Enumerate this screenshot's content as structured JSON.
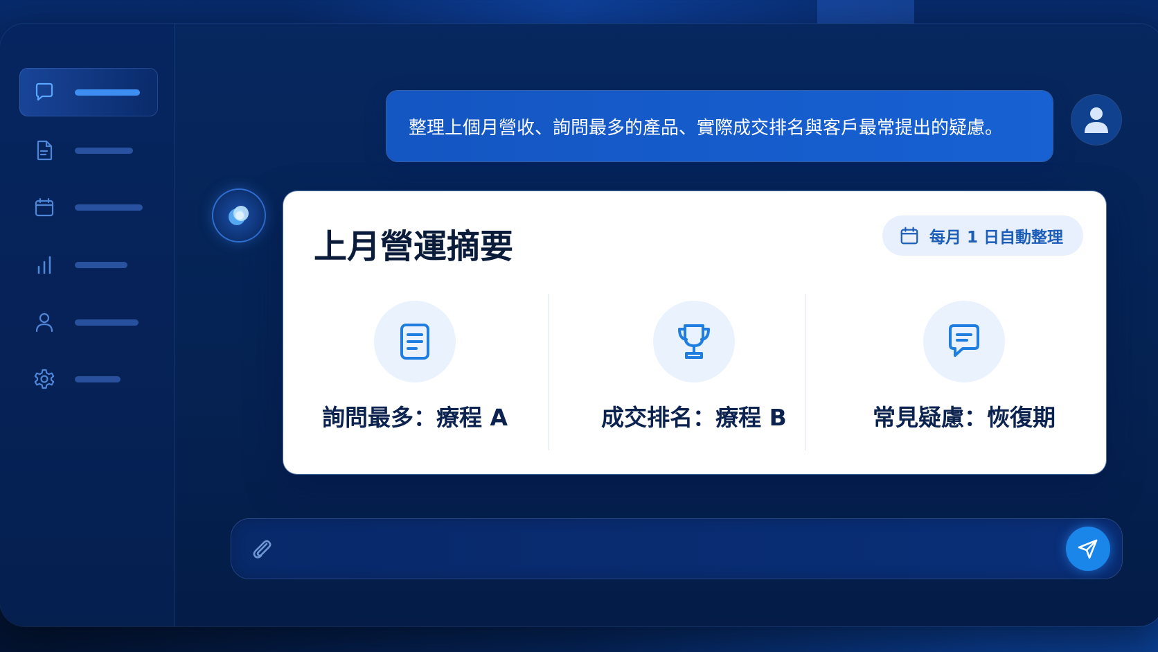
{
  "colors": {
    "background": "#052252",
    "accent": "#1a86ea",
    "user_bubble": "#1761d3",
    "card": "#ffffff",
    "card_title": "#0b1b3a",
    "badge_text": "#1c5db8"
  },
  "sidebar": {
    "items": [
      {
        "icon": "chat-bubble-icon",
        "active": true
      },
      {
        "icon": "document-icon",
        "active": false
      },
      {
        "icon": "calendar-icon",
        "active": false
      },
      {
        "icon": "bar-chart-icon",
        "active": false
      },
      {
        "icon": "user-icon",
        "active": false
      },
      {
        "icon": "gear-icon",
        "active": false
      }
    ]
  },
  "conversation": {
    "user_message": "整理上個月營收、詢問最多的產品、實際成交排名與客戶最常提出的疑慮。",
    "user_avatar_icon": "user-icon",
    "assistant_avatar_icon": "ai-orb-icon"
  },
  "summary_card": {
    "title": "上月營運摘要",
    "schedule_badge": {
      "icon": "calendar-icon",
      "label": "每月 1 日自動整理"
    },
    "metrics": [
      {
        "icon": "document-icon",
        "label": "詢問最多：療程 A"
      },
      {
        "icon": "trophy-icon",
        "label": "成交排名：療程 B"
      },
      {
        "icon": "message-icon",
        "label": "常見疑慮：恢復期"
      }
    ]
  },
  "composer": {
    "input_value": "",
    "input_placeholder": "",
    "attach_icon": "paperclip-icon",
    "send_icon": "send-icon"
  }
}
